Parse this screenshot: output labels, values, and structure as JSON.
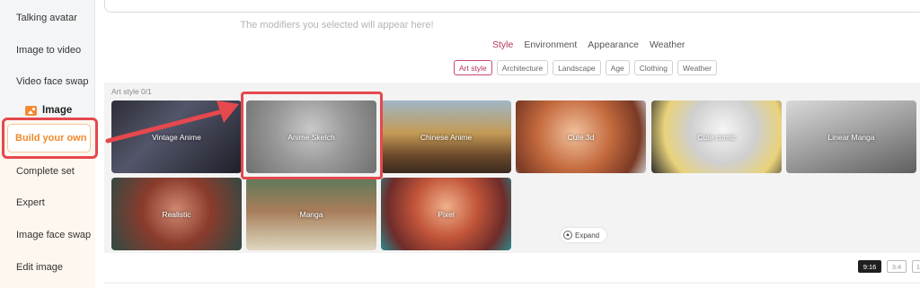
{
  "sidebar": {
    "items_top": [
      {
        "label": "Talking avatar"
      },
      {
        "label": "Image to video"
      },
      {
        "label": "Video face swap"
      }
    ],
    "section_label": "Image",
    "section_icon": "image-icon",
    "active_item": "Build your own",
    "items_bottom": [
      {
        "label": "Complete set"
      },
      {
        "label": "Expert"
      },
      {
        "label": "Image face swap"
      },
      {
        "label": "Edit image"
      }
    ]
  },
  "main": {
    "hint": "The modifiers you selected will appear here!",
    "tabs": [
      {
        "label": "Style"
      },
      {
        "label": "Environment"
      },
      {
        "label": "Appearance"
      },
      {
        "label": "Weather"
      }
    ],
    "chips": [
      {
        "label": "Art style"
      },
      {
        "label": "Architecture"
      },
      {
        "label": "Landscape"
      },
      {
        "label": "Age"
      },
      {
        "label": "Clothing"
      },
      {
        "label": "Weather"
      }
    ],
    "panel_label": "Art style  0/1",
    "cards": [
      {
        "label": "Vintage Anime"
      },
      {
        "label": "Anime Sketch"
      },
      {
        "label": "Chinese Anime"
      },
      {
        "label": "Cute 3d"
      },
      {
        "label": "Cute comic"
      },
      {
        "label": "Linear Manga"
      },
      {
        "label": "Realistic"
      },
      {
        "label": "Manga"
      },
      {
        "label": "Pixel"
      }
    ],
    "expand_label": "Expand",
    "ratios": [
      {
        "label": "9:16"
      },
      {
        "label": "3:4"
      },
      {
        "label": "1"
      }
    ]
  },
  "colors": {
    "accent_orange": "#f08a2e",
    "accent_pink": "#b8335a",
    "annotation_red": "#e5484d"
  }
}
